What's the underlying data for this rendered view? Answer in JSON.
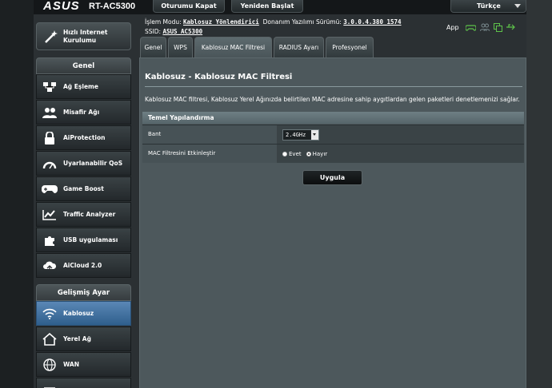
{
  "header": {
    "logo": "ASUS",
    "model": "RT-AC5300",
    "logout_label": "Oturumu Kapat",
    "reboot_label": "Yeniden Başlat",
    "language": "Türkçe"
  },
  "info": {
    "mode_label": "İşlem Modu:",
    "mode_value": "Kablosuz Yönlendirici",
    "firmware_label": "Donanım Yazılımı Sürümü:",
    "firmware_value": "3.0.0.4.380_1574",
    "ssid_label": "SSID:",
    "ssid_value": "ASUS_AC5300",
    "app_label": "App"
  },
  "sidebar": {
    "quick_setup": "Hızlı Internet Kurulumu",
    "general_header": "Genel",
    "general_items": [
      {
        "label": "Ağ Eşleme",
        "icon": "network-map-icon"
      },
      {
        "label": "Misafir Ağı",
        "icon": "guest-network-icon"
      },
      {
        "label": "AiProtection",
        "icon": "lock-icon"
      },
      {
        "label": "Uyarlanabilir QoS",
        "icon": "qos-gauge-icon"
      },
      {
        "label": "Game Boost",
        "icon": "gamepad-icon"
      },
      {
        "label": "Traffic Analyzer",
        "icon": "traffic-chart-icon"
      },
      {
        "label": "USB uygulaması",
        "icon": "puzzle-icon"
      },
      {
        "label": "AiCloud 2.0",
        "icon": "cloud-icon"
      }
    ],
    "advanced_header": "Gelişmiş Ayar",
    "advanced_items": [
      {
        "label": "Kablosuz",
        "icon": "wifi-icon",
        "active": true
      },
      {
        "label": "Yerel Ağ",
        "icon": "home-icon"
      },
      {
        "label": "WAN",
        "icon": "globe-icon"
      }
    ]
  },
  "tabs": [
    "Genel",
    "WPS",
    "Kablosuz MAC Filtresi",
    "RADIUS Ayarı",
    "Profesyonel"
  ],
  "active_tab": "Kablosuz MAC Filtresi",
  "main": {
    "title": "Kablosuz - Kablosuz MAC Filtresi",
    "description": "Kablosuz MAC filtresi, Kablosuz Yerel Ağınızda belirtilen MAC adresine sahip aygıtlardan gelen paketleri denetlemenizi sağlar.",
    "section_header": "Temel Yapılandırma",
    "band_label": "Bant",
    "band_value": "2.4GHz",
    "enable_label": "MAC Filtresini Etkinleştir",
    "yes_label": "Evet",
    "no_label": "Hayır",
    "enable_selected": "no",
    "apply_label": "Uygula"
  },
  "colors": {
    "background": "#2b3033",
    "panel": "#4d585c",
    "active_nav": "#4a78a8",
    "app_icons": "#5ec24a"
  }
}
